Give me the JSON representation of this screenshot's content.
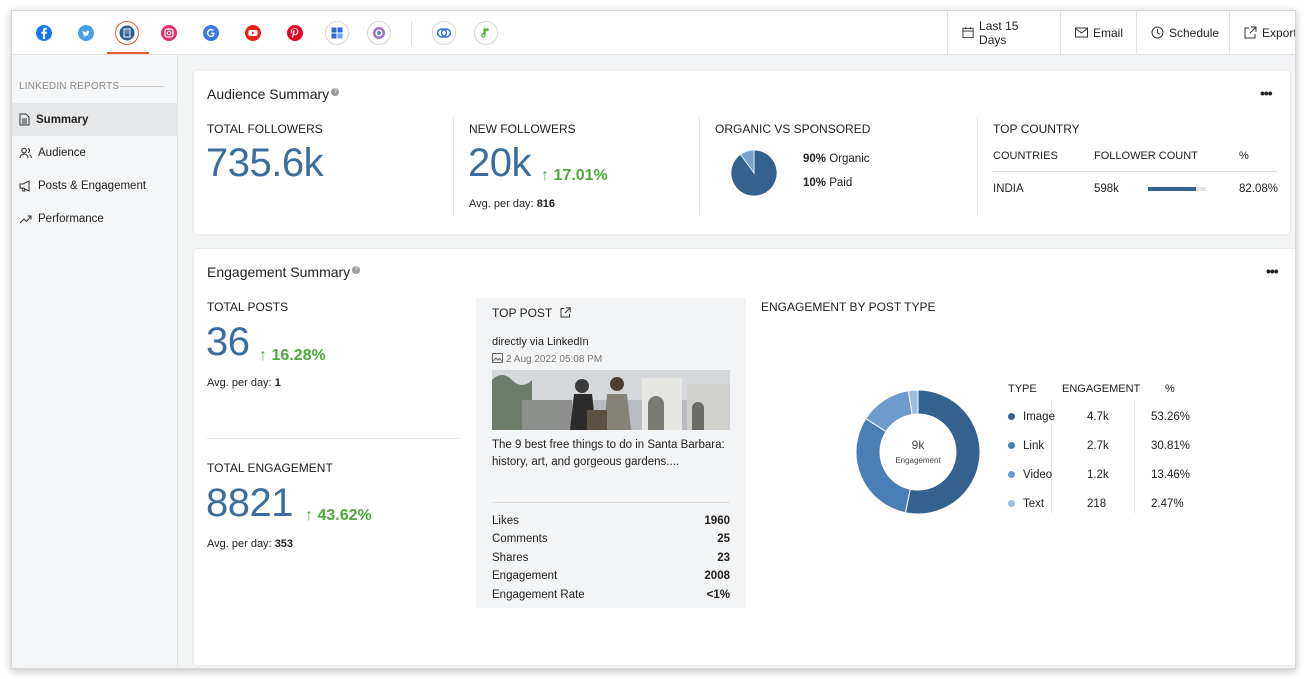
{
  "topbar": {
    "networks": [
      {
        "name": "facebook",
        "color": "#1877f2"
      },
      {
        "name": "twitter",
        "color": "#4a9ee8"
      },
      {
        "name": "linkedin",
        "color": "#2c5c8f",
        "active": true
      },
      {
        "name": "instagram",
        "color": "#e1306c"
      },
      {
        "name": "google",
        "color": "#4285f4"
      },
      {
        "name": "youtube",
        "color": "#e62117"
      },
      {
        "name": "pinterest",
        "color": "#e60023"
      },
      {
        "name": "google-business",
        "color": "#2a6bd6"
      },
      {
        "name": "custom-app",
        "color": "#8a5db8"
      },
      {
        "name": "integration",
        "color": "#2a6bd6"
      },
      {
        "name": "tiktok-like",
        "color": "#4caa3a"
      }
    ],
    "date_range": "Last 15 Days",
    "email": "Email",
    "schedule": "Schedule",
    "export": "Export"
  },
  "sidebar": {
    "heading": "LINKEDIN REPORTS",
    "items": [
      {
        "label": "Summary",
        "icon": "document-icon",
        "active": true
      },
      {
        "label": "Audience",
        "icon": "people-icon"
      },
      {
        "label": "Posts & Engagement",
        "icon": "megaphone-icon"
      },
      {
        "label": "Performance",
        "icon": "trend-icon"
      }
    ]
  },
  "audience": {
    "title": "Audience Summary",
    "total_followers_label": "TOTAL FOLLOWERS",
    "total_followers": "735.6k",
    "new_followers_label": "NEW FOLLOWERS",
    "new_followers": "20k",
    "new_followers_change": "17.01%",
    "avg_label": "Avg. per day:",
    "avg_value": "816",
    "organic_label": "ORGANIC VS SPONSORED",
    "organic_pct": "90%",
    "organic_text": "Organic",
    "paid_pct": "10%",
    "paid_text": "Paid",
    "organic_fraction": 0.9,
    "top_country_label": "TOP COUNTRY",
    "col_countries": "COUNTRIES",
    "col_followers": "FOLLOWER COUNT",
    "col_pct": "%",
    "country": "INDIA",
    "country_count": "598k",
    "country_pct": "82.08%",
    "country_fraction": 0.8208
  },
  "engagement": {
    "title": "Engagement Summary",
    "total_posts_label": "TOTAL POSTS",
    "total_posts": "36",
    "total_posts_change": "16.28%",
    "posts_avg_label": "Avg. per day:",
    "posts_avg_value": "1",
    "total_eng_label": "TOTAL ENGAGEMENT",
    "total_eng": "8821",
    "total_eng_change": "43.62%",
    "eng_avg_label": "Avg. per day:",
    "eng_avg_value": "353",
    "top_post": {
      "label": "TOP POST",
      "source": "directly via LinkedIn",
      "date": "2 Aug 2022 05:08 PM",
      "text": "The 9 best free things to do in Santa Barbara: history, art, and gorgeous gardens....",
      "stats": [
        {
          "label": "Likes",
          "value": "1960"
        },
        {
          "label": "Comments",
          "value": "25"
        },
        {
          "label": "Shares",
          "value": "23"
        },
        {
          "label": "Engagement",
          "value": "2008"
        },
        {
          "label": "Engagement Rate",
          "value": "<1%"
        }
      ]
    },
    "by_type_label": "ENGAGEMENT BY POST TYPE",
    "donut_center_value": "9k",
    "donut_center_label": "Engagement",
    "col_type": "TYPE",
    "col_engagement": "ENGAGEMENT",
    "col_pct": "%"
  },
  "chart_data": {
    "type": "pie",
    "categories": [
      "Image",
      "Link",
      "Video",
      "Text"
    ],
    "display_values": [
      "4.7k",
      "2.7k",
      "1.2k",
      "218"
    ],
    "values": [
      53.26,
      30.81,
      13.46,
      2.47
    ],
    "percent_labels": [
      "53.26%",
      "30.81%",
      "13.46%",
      "2.47%"
    ],
    "colors": [
      "#35618e",
      "#4a7fb5",
      "#6d9ccc",
      "#9dbde0"
    ]
  }
}
